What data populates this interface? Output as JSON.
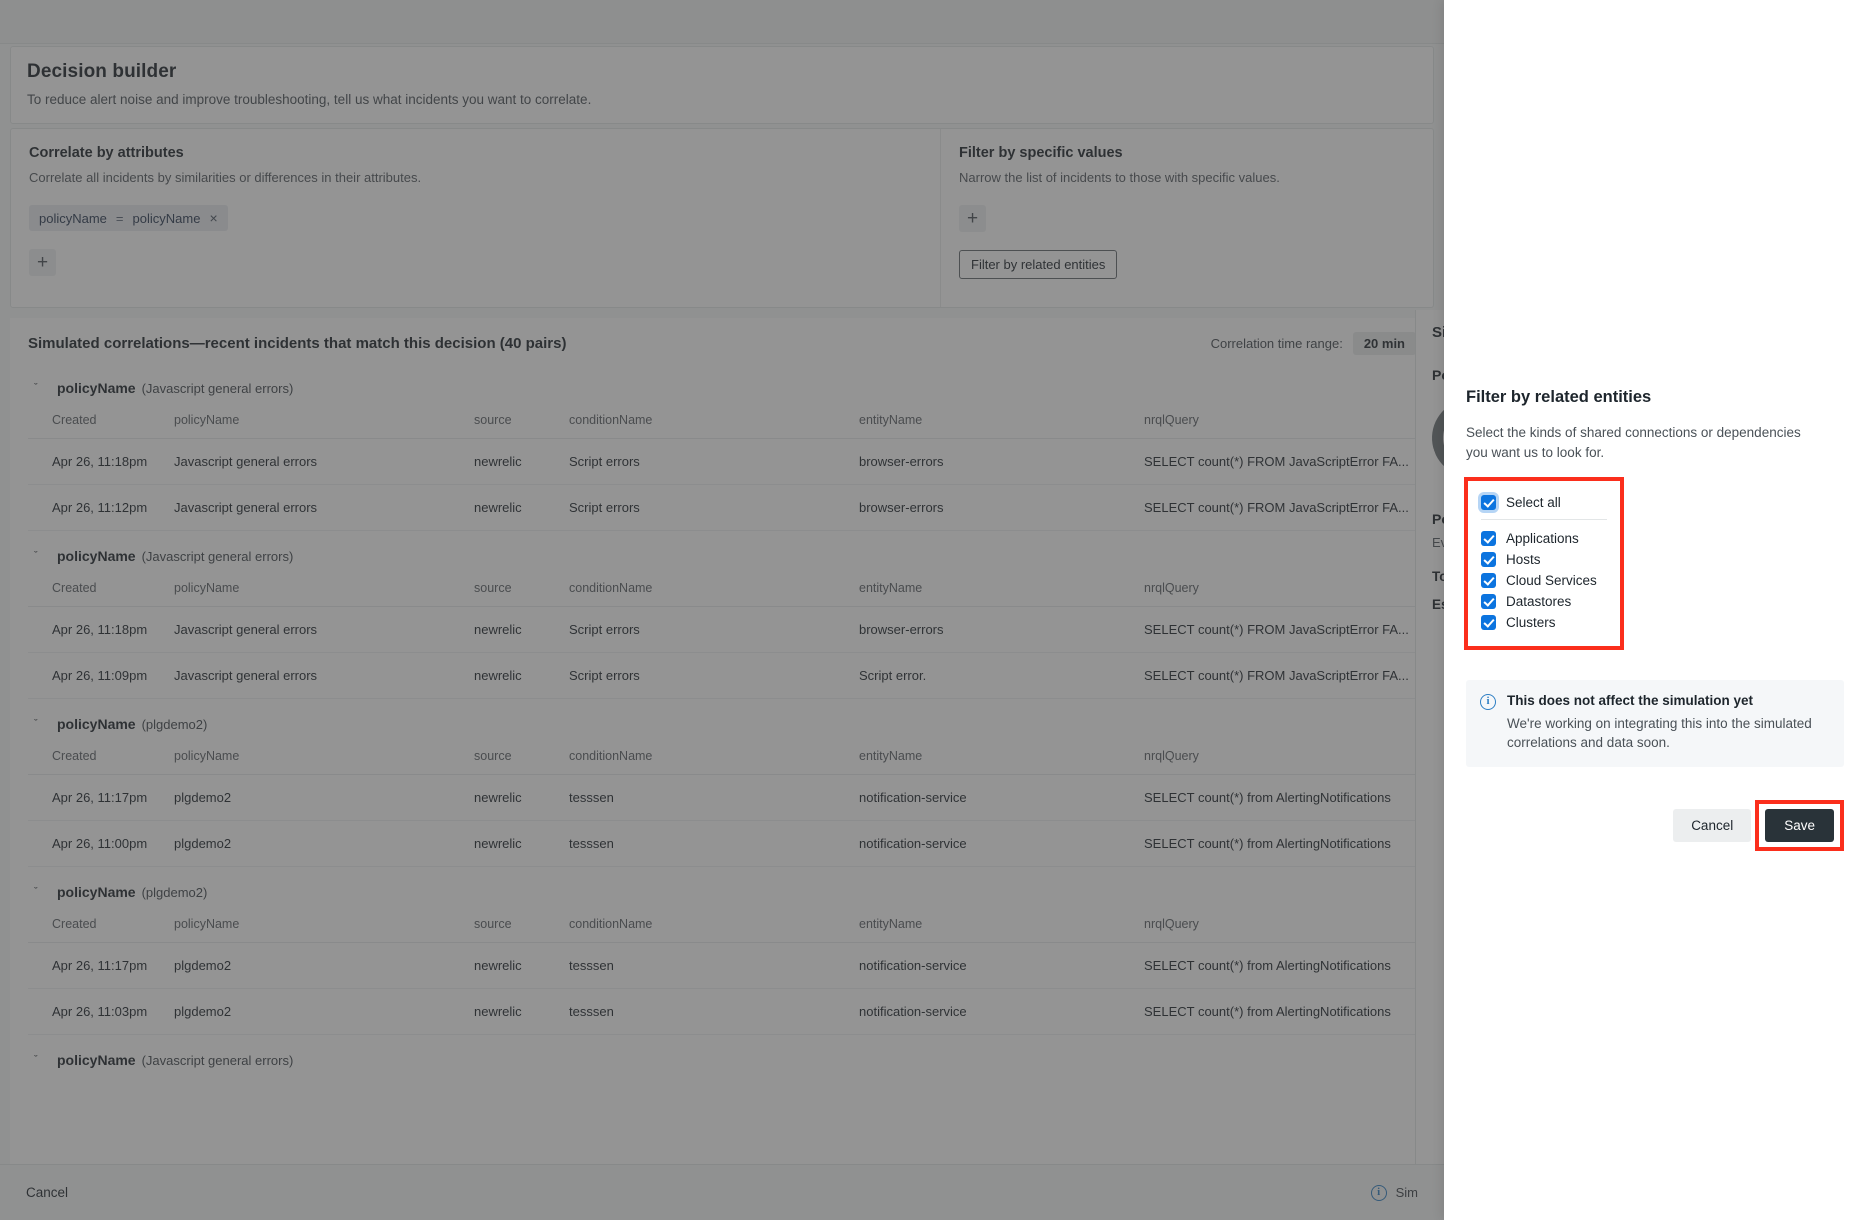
{
  "header": {
    "title": "Decision builder",
    "subtitle": "To reduce alert noise and improve troubleshooting, tell us what incidents you want to correlate."
  },
  "correlate_panel": {
    "title": "Correlate by attributes",
    "subtitle": "Correlate all incidents by similarities or differences in their attributes.",
    "chip": {
      "left": "policyName",
      "operator": "=",
      "right": "policyName",
      "remove": "×"
    },
    "add_label": "+"
  },
  "filter_panel": {
    "title": "Filter by specific values",
    "subtitle": "Narrow the list of incidents to those with specific values.",
    "add_label": "+",
    "related_entities_button": "Filter by related entities"
  },
  "simulation": {
    "title": "Simulated correlations—recent incidents that match this decision (40 pairs)",
    "range_label": "Correlation time range:",
    "range_value": "20 min",
    "columns": [
      "Created",
      "policyName",
      "source",
      "conditionName",
      "entityName",
      "nrqlQuery"
    ],
    "groups": [
      {
        "name": "policyName",
        "qualifier": "(Javascript general errors)",
        "caret": "ˇ",
        "rows": [
          [
            "Apr 26, 11:18pm",
            "Javascript general errors",
            "newrelic",
            "Script errors",
            "browser-errors",
            "SELECT count(*) FROM JavaScriptError FA..."
          ],
          [
            "Apr 26, 11:12pm",
            "Javascript general errors",
            "newrelic",
            "Script errors",
            "browser-errors",
            "SELECT count(*) FROM JavaScriptError FA..."
          ]
        ]
      },
      {
        "name": "policyName",
        "qualifier": "(Javascript general errors)",
        "caret": "ˇ",
        "rows": [
          [
            "Apr 26, 11:18pm",
            "Javascript general errors",
            "newrelic",
            "Script errors",
            "browser-errors",
            "SELECT count(*) FROM JavaScriptError FA..."
          ],
          [
            "Apr 26, 11:09pm",
            "Javascript general errors",
            "newrelic",
            "Script errors",
            "Script error.",
            "SELECT count(*) FROM JavaScriptError FA..."
          ]
        ]
      },
      {
        "name": "policyName",
        "qualifier": "(plgdemo2)",
        "caret": "ˇ",
        "rows": [
          [
            "Apr 26, 11:17pm",
            "plgdemo2",
            "newrelic",
            "tesssen",
            "notification-service",
            "SELECT count(*) from AlertingNotifications"
          ],
          [
            "Apr 26, 11:00pm",
            "plgdemo2",
            "newrelic",
            "tesssen",
            "notification-service",
            "SELECT count(*) from AlertingNotifications"
          ]
        ]
      },
      {
        "name": "policyName",
        "qualifier": "(plgdemo2)",
        "caret": "ˇ",
        "rows": [
          [
            "Apr 26, 11:17pm",
            "plgdemo2",
            "newrelic",
            "tesssen",
            "notification-service",
            "SELECT count(*) from AlertingNotifications"
          ],
          [
            "Apr 26, 11:03pm",
            "plgdemo2",
            "newrelic",
            "tesssen",
            "notification-service",
            "SELECT count(*) from AlertingNotifications"
          ]
        ]
      },
      {
        "name": "policyName",
        "qualifier": "(Javascript general errors)",
        "caret": "ˇ",
        "rows": []
      }
    ]
  },
  "side_panel": {
    "title": "Sim",
    "label_1": "Pot",
    "label_2": "Pot",
    "sub_2": "Eve",
    "label_3": "Tot",
    "label_4": "Est"
  },
  "footer": {
    "cancel": "Cancel",
    "info_icon": "i",
    "status": "Sim"
  },
  "modal": {
    "title": "Filter by related entities",
    "description": "Select the kinds of shared connections or dependencies you want us to look for.",
    "select_all": {
      "label": "Select all",
      "checked": true,
      "focused": true
    },
    "options": [
      {
        "label": "Applications",
        "checked": true
      },
      {
        "label": "Hosts",
        "checked": true
      },
      {
        "label": "Cloud Services",
        "checked": true
      },
      {
        "label": "Datastores",
        "checked": true
      },
      {
        "label": "Clusters",
        "checked": true
      }
    ],
    "info": {
      "icon": "i",
      "title": "This does not affect the simulation yet",
      "text": "We're working on integrating this into the simulated correlations and data soon."
    },
    "cancel_label": "Cancel",
    "save_label": "Save"
  },
  "colors": {
    "accent_blue": "#0c74df",
    "highlight_red": "#fb2e1c",
    "save_dark": "#293339"
  }
}
